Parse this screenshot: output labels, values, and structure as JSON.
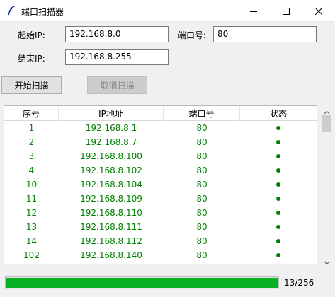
{
  "window": {
    "title": "端口扫描器"
  },
  "form": {
    "start_ip_label": "起始IP:",
    "start_ip_value": "192.168.8.0",
    "port_label": "端口号:",
    "port_value": "80",
    "end_ip_label": "结束IP:",
    "end_ip_value": "192.168.8.255"
  },
  "buttons": {
    "start": "开始扫描",
    "cancel": "取消扫描"
  },
  "table": {
    "columns": [
      "序号",
      "IP地址",
      "端口号",
      "状态"
    ],
    "status_color": "#008000",
    "rows": [
      {
        "seq": "1",
        "ip": "192.168.8.1",
        "port": "80"
      },
      {
        "seq": "2",
        "ip": "192.168.8.7",
        "port": "80"
      },
      {
        "seq": "3",
        "ip": "192.168.8.100",
        "port": "80"
      },
      {
        "seq": "4",
        "ip": "192.168.8.102",
        "port": "80"
      },
      {
        "seq": "10",
        "ip": "192.168.8.104",
        "port": "80"
      },
      {
        "seq": "11",
        "ip": "192.168.8.109",
        "port": "80"
      },
      {
        "seq": "12",
        "ip": "192.168.8.110",
        "port": "80"
      },
      {
        "seq": "13",
        "ip": "192.168.8.111",
        "port": "80"
      },
      {
        "seq": "14",
        "ip": "192.168.8.112",
        "port": "80"
      },
      {
        "seq": "102",
        "ip": "192.168.8.140",
        "port": "80"
      }
    ]
  },
  "progress": {
    "text": "13/256",
    "fraction": 1.0,
    "color": "#06b025"
  },
  "icons": {
    "app": "feather-icon",
    "minimize": "minimize-icon",
    "maximize": "maximize-icon",
    "close": "close-icon"
  }
}
